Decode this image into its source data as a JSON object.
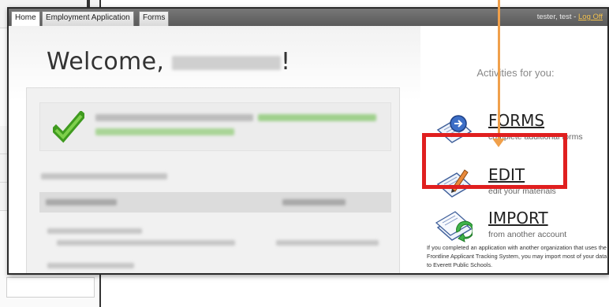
{
  "tabs": [
    "Home",
    "Employment Application",
    "Forms"
  ],
  "header": {
    "user_label": "tester, test -",
    "logoff_label": "Log Off"
  },
  "main": {
    "welcome_prefix": "Welcome,",
    "welcome_suffix": "!"
  },
  "sidebar": {
    "title": "Activities for you:",
    "activities": [
      {
        "name": "FORMS",
        "desc": "complete additional forms",
        "icon": "forms-icon"
      },
      {
        "name": "EDIT",
        "desc": "edit your materials",
        "icon": "edit-icon"
      },
      {
        "name": "IMPORT",
        "desc": "from another account",
        "icon": "import-icon"
      }
    ],
    "import_note": "If you completed an application with another organization that uses the Frontline Applicant Tracking System, you may import most of your data to Everett Public Schools."
  },
  "colors": {
    "highlight": "#e01f1f",
    "arrow": "#f0a04b",
    "tabbar": "#5a5a5a",
    "logoff": "#f2c14e"
  }
}
